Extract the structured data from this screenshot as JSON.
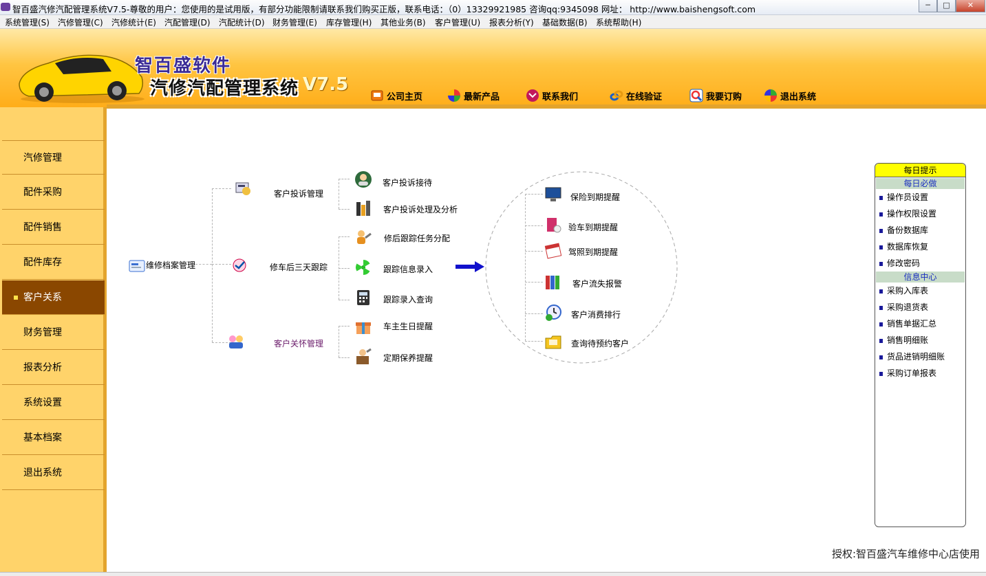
{
  "window": {
    "title": "智百盛汽修汽配管理系统V7.5-尊敬的用户：您使用的是试用版，有部分功能限制请联系我们购买正版，联系电话：（0）13329921985  咨询qq:9345098   网址： http://www.baishengsoft.com",
    "min": "─",
    "max": "□",
    "close": "✕"
  },
  "menu": [
    "系统管理(S)",
    "汽修管理(C)",
    "汽修统计(E)",
    "汽配管理(D)",
    "汽配统计(D)",
    "财务管理(E)",
    "库存管理(H)",
    "其他业务(B)",
    "客户管理(U)",
    "报表分析(Y)",
    "基础数据(B)",
    "系统帮助(H)"
  ],
  "brand": {
    "line1": "智百盛软件",
    "line2": "汽修汽配管理系统",
    "version": "V7.5"
  },
  "topnav": [
    "公司主页",
    "最新产品",
    "联系我们",
    "在线验证",
    "我要订购",
    "退出系统"
  ],
  "sidebar": [
    "汽修管理",
    "配件采购",
    "配件销售",
    "配件库存",
    "客户关系",
    "财务管理",
    "报表分析",
    "系统设置",
    "基本档案",
    "退出系统"
  ],
  "flow": {
    "root": "维修档案管理",
    "groups": [
      "客户投诉管理",
      "修车后三天跟踪",
      "客户关怀管理"
    ],
    "leaves": [
      "客户投诉接待",
      "客户投诉处理及分析",
      "修后跟踪任务分配",
      "跟踪信息录入",
      "跟踪录入查询",
      "车主生日提醒",
      "定期保养提醒"
    ],
    "circle": [
      "保险到期提醒",
      "验车到期提醒",
      "驾照到期提醒",
      "客户流失报警",
      "客户消费排行",
      "查询待预约客户"
    ]
  },
  "tips": {
    "title": "每日提示",
    "sec1": "每日必做",
    "items1": [
      "操作员设置",
      "操作权限设置",
      "备份数据库",
      "数据库恢复",
      "修改密码"
    ],
    "sec2": "信息中心",
    "items2": [
      "采购入库表",
      "采购退货表",
      "销售单据汇总",
      "销售明细账",
      "货品进销明细账",
      "采购订单报表"
    ]
  },
  "license": "授权:智百盛汽车维修中心店使用",
  "colors": {
    "banner": "#ffc542",
    "sidebar": "#ffd36a",
    "active": "#8a4700",
    "accent_blue": "#1111cc"
  }
}
